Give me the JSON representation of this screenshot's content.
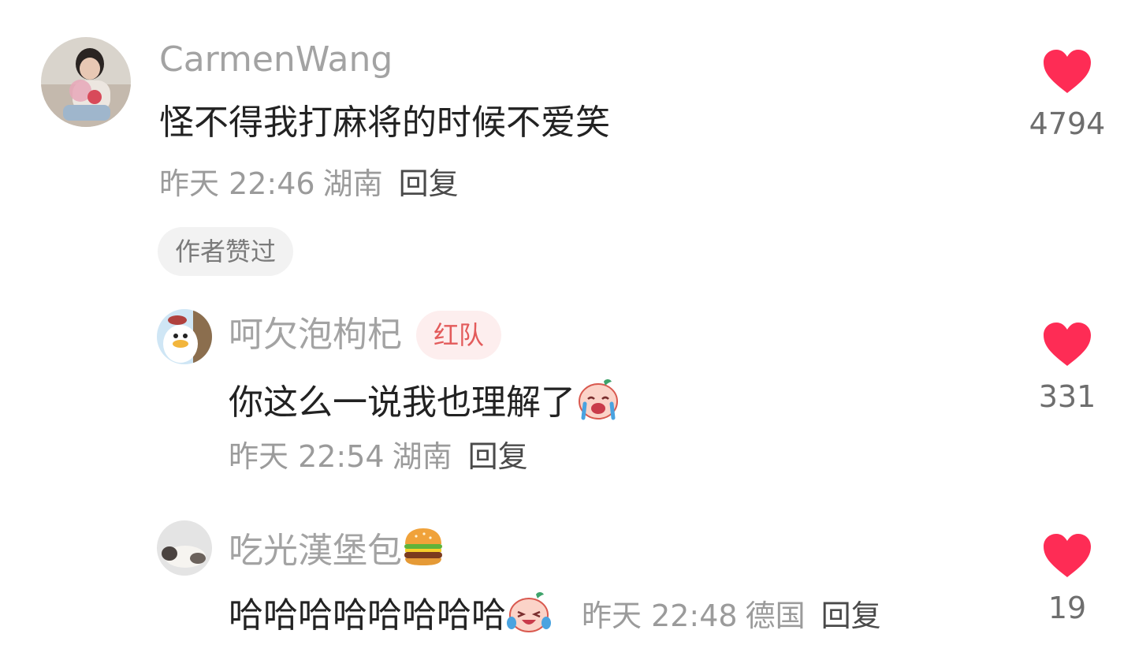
{
  "comments": [
    {
      "username": "CarmenWang",
      "text": "怪不得我打麻将的时候不爱笑",
      "time": "昨天 22:46",
      "location": "湖南",
      "reply_label": "回复",
      "author_liked_label": "作者赞过",
      "likes": "4794",
      "avatar": "avatar-photo-woman"
    },
    {
      "username": "呵欠泡枸杞",
      "badge": "红队",
      "text": "你这么一说我也理解了",
      "text_emoji": "crying-laughing-emoji",
      "time": "昨天 22:54",
      "location": "湖南",
      "reply_label": "回复",
      "likes": "331",
      "avatar": "avatar-cartoon-duck"
    },
    {
      "username": "吃光漢堡包",
      "username_emoji": "hamburger-emoji",
      "text": "哈哈哈哈哈哈哈哈",
      "text_emoji": "laughing-tears-emoji",
      "time": "昨天 22:48",
      "location": "德国",
      "reply_label": "回复",
      "likes": "19",
      "avatar": "avatar-photo-cat"
    }
  ],
  "colors": {
    "like_heart": "#fe2c55",
    "username": "#a3a3a3",
    "badge_text": "#e35b5b",
    "badge_bg": "#fdeeee"
  }
}
